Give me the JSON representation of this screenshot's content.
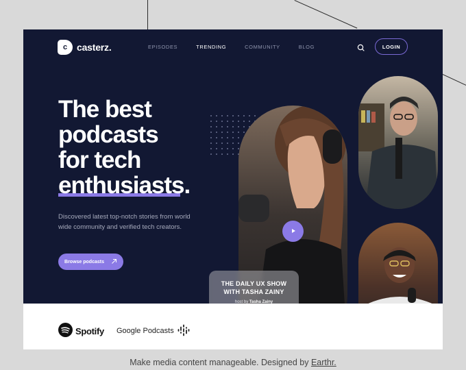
{
  "brand": {
    "logo_letter": "c",
    "name": "casterz."
  },
  "nav": {
    "items": [
      {
        "label": "EPISODES"
      },
      {
        "label": "TRENDING"
      },
      {
        "label": "COMMUNITY"
      },
      {
        "label": "BLOG"
      }
    ],
    "active": "TRENDING",
    "search_icon": "search-icon",
    "login_label": "LOGIN"
  },
  "hero": {
    "title_line1": "The best",
    "title_line2": "podcasts",
    "title_line3": "for tech",
    "title_line4": "enthusiasts",
    "title_period": ".",
    "subtitle": "Discovered latest top-notch stories from world wide community and verified tech creators.",
    "cta_label": "Browse podcasts"
  },
  "show_card": {
    "title_line1": "THE DAILY UX SHOW",
    "title_line2": "WITH TASHA ZAINY",
    "host_prefix": "host by",
    "host_name": "Tasha Zainy"
  },
  "partners": {
    "spotify": "Spotify",
    "google": "Google Podcasts"
  },
  "caption": {
    "text": "Make media content manageable. Designed by ",
    "link": "Earthr."
  },
  "colors": {
    "navy": "#121833",
    "accent": "#8b7ae6",
    "page_bg": "#d9d9d9"
  }
}
